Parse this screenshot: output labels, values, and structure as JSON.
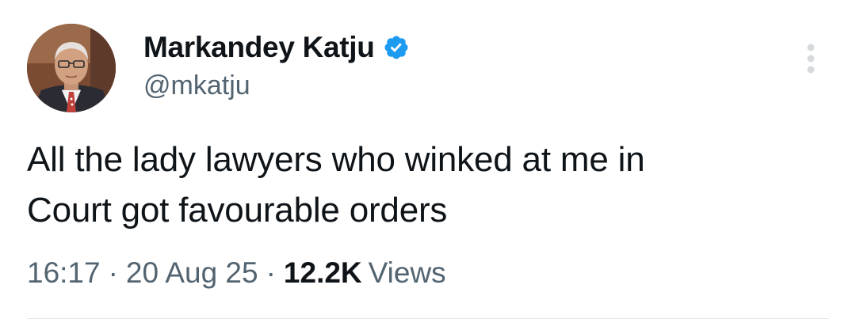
{
  "author": {
    "display_name": "Markandey Katju",
    "handle": "@mkatju",
    "verified": true,
    "avatar_icon": "profile-photo-man-in-suit"
  },
  "tweet": {
    "text_lines": [
      "All the lady lawyers who winked at me in",
      "Court got favourable orders"
    ]
  },
  "meta": {
    "time": "16:17",
    "separator": "·",
    "date": "20 Aug 25",
    "views_count": "12.2K",
    "views_label": "Views"
  },
  "icons": {
    "verified": "verified-badge-icon",
    "more": "more-options-vertical-icon"
  },
  "colors": {
    "text_primary": "#0f1419",
    "text_secondary": "#536471",
    "verified_blue": "#1d9bf0",
    "more_icon": "#d6dadd",
    "divider": "#e3e7ea"
  }
}
